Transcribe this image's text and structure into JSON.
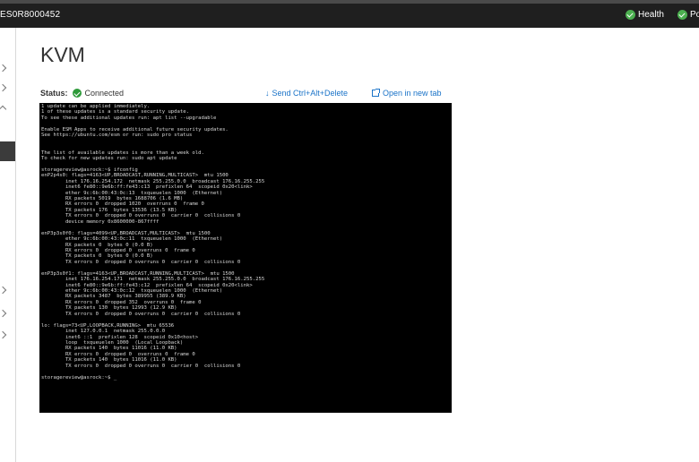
{
  "header": {
    "device_name": "ES0R8000452",
    "health_label": "Health",
    "power_label": "Po"
  },
  "page": {
    "title": "KVM"
  },
  "status": {
    "label": "Status:",
    "value": "Connected"
  },
  "actions": {
    "send_cad": "Send Ctrl+Alt+Delete",
    "open_tab": "Open in new tab"
  },
  "colors": {
    "topbar": "#1f1f1f",
    "ok_green": "#2e9a3a",
    "link_blue": "#1a73c8",
    "terminal_bg": "#000000"
  },
  "terminal": {
    "lines": [
      "1 update can be applied immediately.",
      "1 of these updates is a standard security update.",
      "To see these additional updates run: apt list --upgradable",
      "",
      "Enable ESM Apps to receive additional future security updates.",
      "See https://ubuntu.com/esm or run: sudo pro status",
      "",
      "",
      "The list of available updates is more than a week old.",
      "To check for new updates run: sudo apt update",
      "",
      "storagereview@asrock:~$ ifconfig",
      "enP2p4s0: flags=4163<UP,BROADCAST,RUNNING,MULTICAST>  mtu 1500",
      "        inet 176.16.254.172  netmask 255.255.0.0  broadcast 176.16.255.255",
      "        inet6 fe80::9e6b:ff:fe43:c13  prefixlen 64  scopeid 0x20<link>",
      "        ether 9c:6b:00:43:0c:13  txqueuelen 1000  (Ethernet)",
      "        RX packets 5019  bytes 1688706 (1.6 MB)",
      "        RX errors 0  dropped 1020  overruns 0  frame 0",
      "        TX packets 176  bytes 13536 (13.5 KB)",
      "        TX errors 0  dropped 0 overruns 0  carrier 0  collisions 0",
      "        device memory 0x8600000-867ffff",
      "",
      "enP3p3s0f0: flags=4099<UP,BROADCAST,MULTICAST>  mtu 1500",
      "        ether 9c:6b:00:43:0c:11  txqueuelen 1000  (Ethernet)",
      "        RX packets 0  bytes 0 (0.0 B)",
      "        RX errors 0  dropped 0  overruns 0  frame 0",
      "        TX packets 0  bytes 0 (0.0 B)",
      "        TX errors 0  dropped 0 overruns 0  carrier 0  collisions 0",
      "",
      "enP3p3s0f1: flags=4163<UP,BROADCAST,RUNNING,MULTICAST>  mtu 1500",
      "        inet 176.16.254.171  netmask 255.255.0.0  broadcast 176.16.255.255",
      "        inet6 fe80::9e6b:ff:fe43:c12  prefixlen 64  scopeid 0x20<link>",
      "        ether 9c:6b:00:43:0c:12  txqueuelen 1000  (Ethernet)",
      "        RX packets 3487  bytes 389955 (389.9 KB)",
      "        RX errors 0  dropped 352  overruns 0  frame 0",
      "        TX packets 130  bytes 12993 (12.9 KB)",
      "        TX errors 0  dropped 0 overruns 0  carrier 0  collisions 0",
      "",
      "lo: flags=73<UP,LOOPBACK,RUNNING>  mtu 65536",
      "        inet 127.0.0.1  netmask 255.0.0.0",
      "        inet6 ::1  prefixlen 128  scopeid 0x10<host>",
      "        loop  txqueuelen 1000  (Local Loopback)",
      "        RX packets 140  bytes 11016 (11.0 KB)",
      "        RX errors 0  dropped 0  overruns 0  frame 0",
      "        TX packets 140  bytes 11016 (11.0 KB)",
      "        TX errors 0  dropped 0 overruns 0  carrier 0  collisions 0",
      "",
      "storagereview@asrock:~$ _"
    ]
  }
}
